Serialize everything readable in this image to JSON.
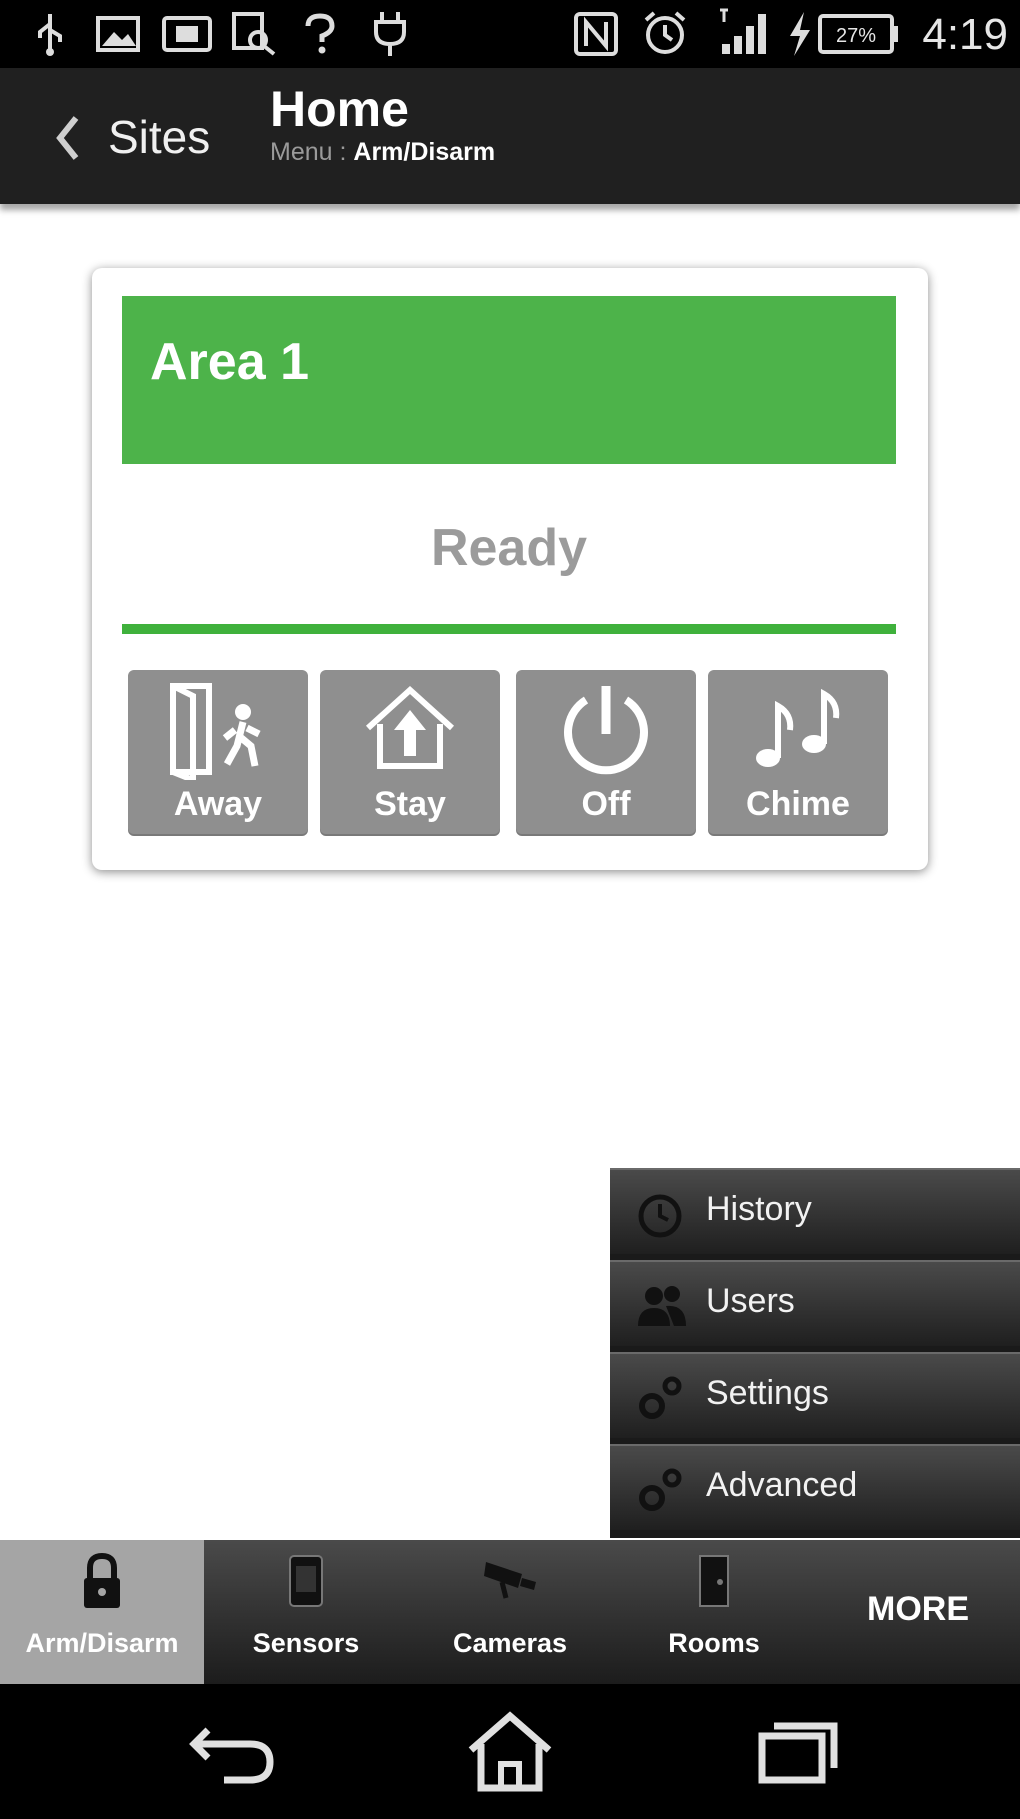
{
  "status_bar": {
    "time": "4:19",
    "battery_percent": "27%",
    "icons": [
      "usb-icon",
      "image-icon",
      "sd-card-icon",
      "search-doc-icon",
      "question-icon",
      "power-plug-icon",
      "nfc-icon",
      "alarm-icon",
      "signal-icon",
      "charging-icon",
      "battery-icon"
    ]
  },
  "header": {
    "back_label": "Sites",
    "title": "Home",
    "menu_prefix": "Menu :",
    "menu_value": "Arm/Disarm"
  },
  "area": {
    "name": "Area 1",
    "status": "Ready",
    "status_color": "#4db34a",
    "modes": [
      {
        "label": "Away",
        "icon": "away-door-icon"
      },
      {
        "label": "Stay",
        "icon": "stay-house-icon"
      },
      {
        "label": "Off",
        "icon": "power-off-icon"
      },
      {
        "label": "Chime",
        "icon": "chime-music-icon"
      }
    ]
  },
  "more_menu": {
    "items": [
      {
        "label": "History",
        "icon": "history-clock-icon"
      },
      {
        "label": "Users",
        "icon": "users-icon"
      },
      {
        "label": "Settings",
        "icon": "settings-gear-icon"
      },
      {
        "label": "Advanced",
        "icon": "advanced-gear-icon"
      }
    ]
  },
  "tabs": {
    "items": [
      {
        "label": "Arm/Disarm",
        "icon": "lock-icon",
        "active": true
      },
      {
        "label": "Sensors",
        "icon": "sensor-icon",
        "active": false
      },
      {
        "label": "Cameras",
        "icon": "camera-icon",
        "active": false
      },
      {
        "label": "Rooms",
        "icon": "room-icon",
        "active": false
      }
    ],
    "more_label": "MORE"
  },
  "nav_bar": {
    "icons": [
      "back-icon",
      "home-icon",
      "recent-apps-icon"
    ]
  }
}
